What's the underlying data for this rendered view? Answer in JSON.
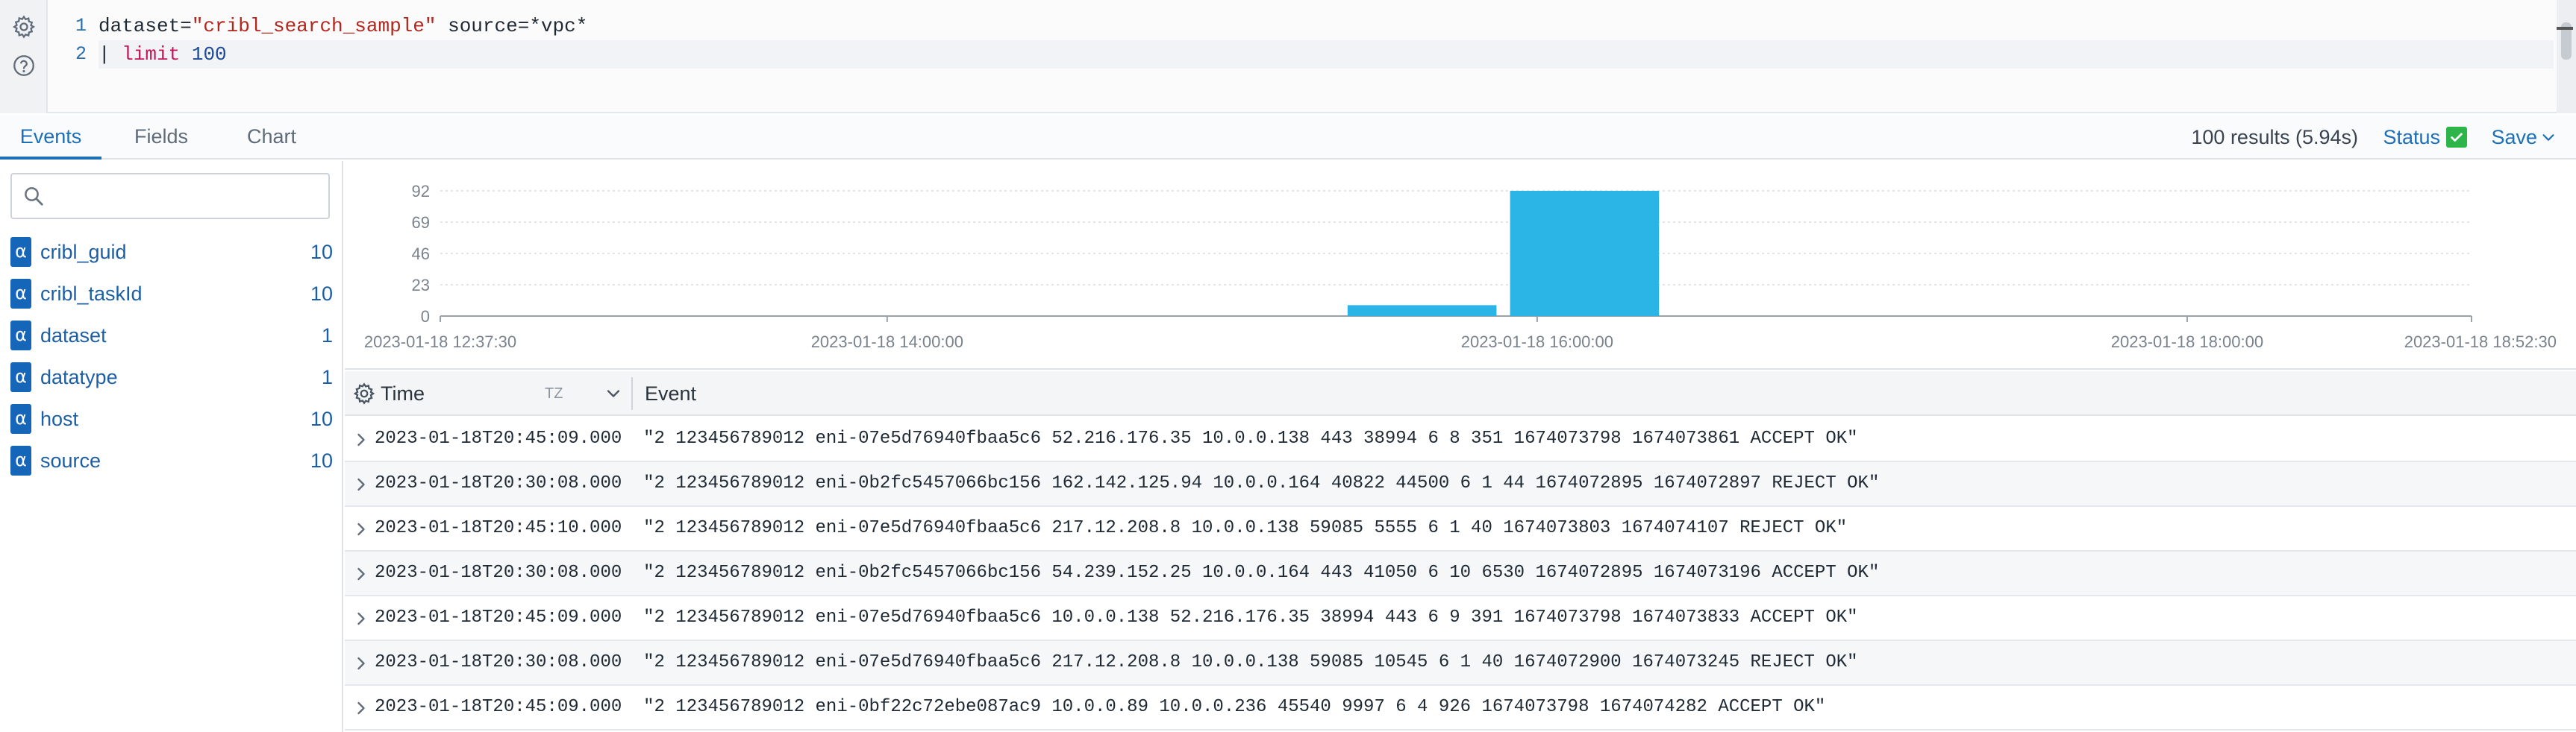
{
  "editor": {
    "line_numbers": [
      "1",
      "2"
    ],
    "line1": {
      "key1": "dataset",
      "op1": "=",
      "str1": "\"cribl_search_sample\"",
      "key2": " source",
      "op2": "=",
      "val2": "*vpc*"
    },
    "line2": {
      "pipe": "| ",
      "keyword": "limit",
      "space": " ",
      "number": "100"
    }
  },
  "tabs": [
    {
      "label": "Events",
      "active": true
    },
    {
      "label": "Fields",
      "active": false
    },
    {
      "label": "Chart",
      "active": false
    }
  ],
  "toolbar": {
    "results": "100 results (5.94s)",
    "status_label": "Status",
    "save_label": "Save"
  },
  "sidebar": {
    "search": {
      "value": "",
      "placeholder": ""
    },
    "fields": [
      {
        "type": "α",
        "name": "cribl_guid",
        "count": "10"
      },
      {
        "type": "α",
        "name": "cribl_taskId",
        "count": "10"
      },
      {
        "type": "α",
        "name": "dataset",
        "count": "1"
      },
      {
        "type": "α",
        "name": "datatype",
        "count": "1"
      },
      {
        "type": "α",
        "name": "host",
        "count": "10"
      },
      {
        "type": "α",
        "name": "source",
        "count": "10"
      }
    ]
  },
  "chart_data": {
    "type": "bar",
    "x_start": "2023-01-18 12:37:30",
    "x_end": "2023-01-18 18:52:30",
    "ylim": [
      0,
      92
    ],
    "y_ticks": [
      "0",
      "23",
      "46",
      "69",
      "92"
    ],
    "x_ticks": [
      "2023-01-18 12:37:30",
      "2023-01-18 14:00:00",
      "2023-01-18 16:00:00",
      "2023-01-18 18:00:00",
      "2023-01-18 18:52:30"
    ],
    "bars": [
      {
        "start": "2023-01-18 15:25:00",
        "end": "2023-01-18 15:52:30",
        "value": 8
      },
      {
        "start": "2023-01-18 15:55:00",
        "end": "2023-01-18 16:22:30",
        "value": 92
      }
    ],
    "grid": true,
    "bar_color": "#2bb5e6"
  },
  "table": {
    "headers": {
      "time": "Time",
      "tz": "TZ",
      "event": "Event"
    },
    "rows": [
      {
        "time": "2023-01-18T20:45:09.000",
        "event": "\"2 123456789012 eni-07e5d76940fbaa5c6 52.216.176.35 10.0.0.138 443 38994 6 8 351 1674073798 1674073861 ACCEPT OK\""
      },
      {
        "time": "2023-01-18T20:30:08.000",
        "event": "\"2 123456789012 eni-0b2fc5457066bc156 162.142.125.94 10.0.0.164 40822 44500 6 1 44 1674072895 1674072897 REJECT OK\""
      },
      {
        "time": "2023-01-18T20:45:10.000",
        "event": "\"2 123456789012 eni-07e5d76940fbaa5c6 217.12.208.8 10.0.0.138 59085 5555 6 1 40 1674073803 1674074107 REJECT OK\""
      },
      {
        "time": "2023-01-18T20:30:08.000",
        "event": "\"2 123456789012 eni-0b2fc5457066bc156 54.239.152.25 10.0.0.164 443 41050 6 10 6530 1674072895 1674073196 ACCEPT OK\""
      },
      {
        "time": "2023-01-18T20:45:09.000",
        "event": "\"2 123456789012 eni-07e5d76940fbaa5c6 10.0.0.138 52.216.176.35 38994 443 6 9 391 1674073798 1674073833 ACCEPT OK\""
      },
      {
        "time": "2023-01-18T20:30:08.000",
        "event": "\"2 123456789012 eni-07e5d76940fbaa5c6 217.12.208.8 10.0.0.138 59085 10545 6 1 40 1674072900 1674073245 REJECT OK\""
      },
      {
        "time": "2023-01-18T20:45:09.000",
        "event": "\"2 123456789012 eni-0bf22c72ebe087ac9 10.0.0.89 10.0.0.236 45540 9997 6 4 926 1674073798 1674074282 ACCEPT OK\""
      }
    ]
  }
}
